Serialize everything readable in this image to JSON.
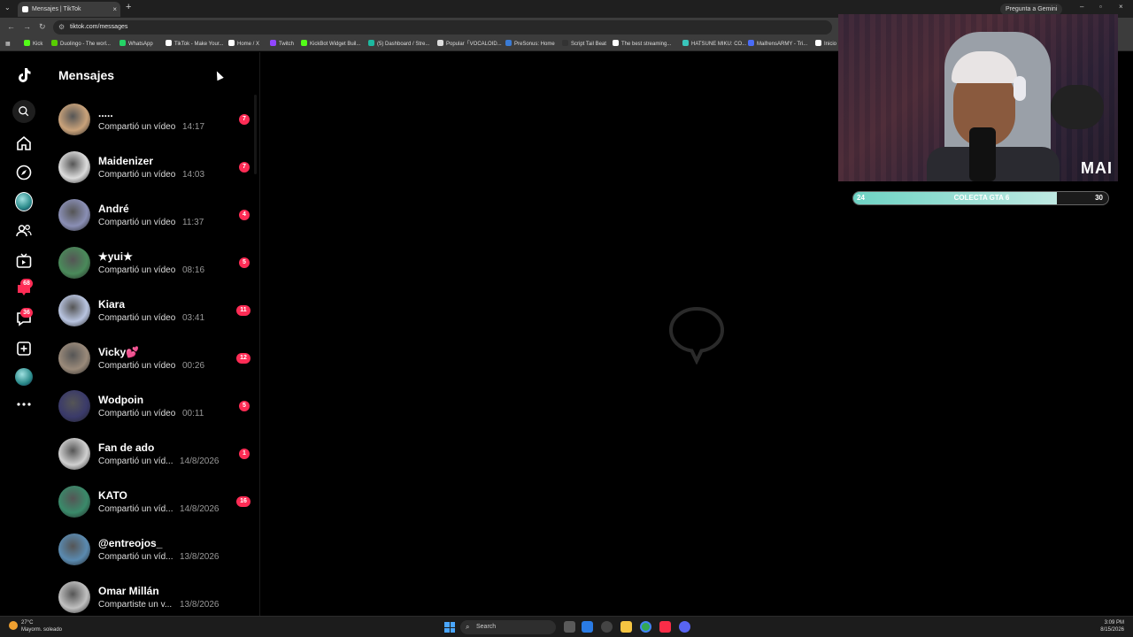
{
  "browser": {
    "tab_title": "Mensajes | TikTok",
    "url": "tiktok.com/messages",
    "gemini_label": "Pregunta a Gemini",
    "bookmarks": [
      {
        "label": "Kick",
        "color": "#53fc18"
      },
      {
        "label": "Duolingo - The worl...",
        "color": "#58cc02"
      },
      {
        "label": "WhatsApp",
        "color": "#25d366"
      },
      {
        "label": "TikTok - Make Your...",
        "color": "#ffffff"
      },
      {
        "label": "Home / X",
        "color": "#ffffff"
      },
      {
        "label": "Twitch",
        "color": "#9146ff"
      },
      {
        "label": "KickBot Widget Buil...",
        "color": "#53fc18"
      },
      {
        "label": "(5) Dashboard / Stre...",
        "color": "#1db9a0"
      },
      {
        "label": "Popular「VOCALOID...",
        "color": "#dddddd"
      },
      {
        "label": "PreSonus: Home",
        "color": "#3a7bd5"
      },
      {
        "label": "Script Tail Beat",
        "color": "#333333"
      },
      {
        "label": "The best streaming...",
        "color": "#ffffff"
      },
      {
        "label": "HATSUNE MIKU: CO...",
        "color": "#39c5bb"
      },
      {
        "label": "MaifrensARMY - Tri...",
        "color": "#4a6cf7"
      },
      {
        "label": "Inicio",
        "color": "#ffffff"
      }
    ]
  },
  "sidebar": {
    "inbox_badge": "68",
    "messages_badge": "36"
  },
  "messages": {
    "title": "Mensajes",
    "conversations": [
      {
        "name": ".....",
        "preview": "Compartió un vídeo",
        "time": "14:17",
        "unread": "7",
        "color": "#c9a27a"
      },
      {
        "name": "Maidenizer",
        "preview": "Compartió un vídeo",
        "time": "14:03",
        "unread": "7",
        "color": "#dcdcdc"
      },
      {
        "name": "André",
        "preview": "Compartió un vídeo",
        "time": "11:37",
        "unread": "4",
        "color": "#8a8fb5"
      },
      {
        "name": "★yui★",
        "preview": "Compartió un vídeo",
        "time": "08:16",
        "unread": "5",
        "color": "#4a8a5a"
      },
      {
        "name": "Kiara",
        "preview": "Compartió un vídeo",
        "time": "03:41",
        "unread": "11",
        "color": "#b8c4e0"
      },
      {
        "name": "Vicky💕",
        "preview": "Compartió un vídeo",
        "time": "00:26",
        "unread": "12",
        "color": "#9a8a7a"
      },
      {
        "name": "Wodpoin",
        "preview": "Compartió un vídeo",
        "time": "00:11",
        "unread": "5",
        "color": "#3a3a6a"
      },
      {
        "name": "Fan de ado",
        "preview": "Compartió un víd...",
        "time": "14/8/2026",
        "unread": "1",
        "color": "#d0d0d0"
      },
      {
        "name": "KATO",
        "preview": "Compartió un víd...",
        "time": "14/8/2026",
        "unread": "16",
        "color": "#3a8a6a"
      },
      {
        "name": "@entreojos_",
        "preview": "Compartió un víd...",
        "time": "13/8/2026",
        "unread": "",
        "color": "#5a8ab0"
      },
      {
        "name": "Omar Millán",
        "preview": "Compartiste un v...",
        "time": "13/8/2026",
        "unread": "",
        "color": "#c0c0c0"
      }
    ]
  },
  "stream_overlay": {
    "logo": "MAI",
    "goal_label": "COLECTA GTA 6",
    "goal_current": "24",
    "goal_target": "30",
    "goal_progress": 0.8
  },
  "taskbar": {
    "temperature": "27°C",
    "weather": "Mayorm. soleado",
    "search": "Search",
    "time": "3:09 PM",
    "date": "8/15/2026"
  }
}
